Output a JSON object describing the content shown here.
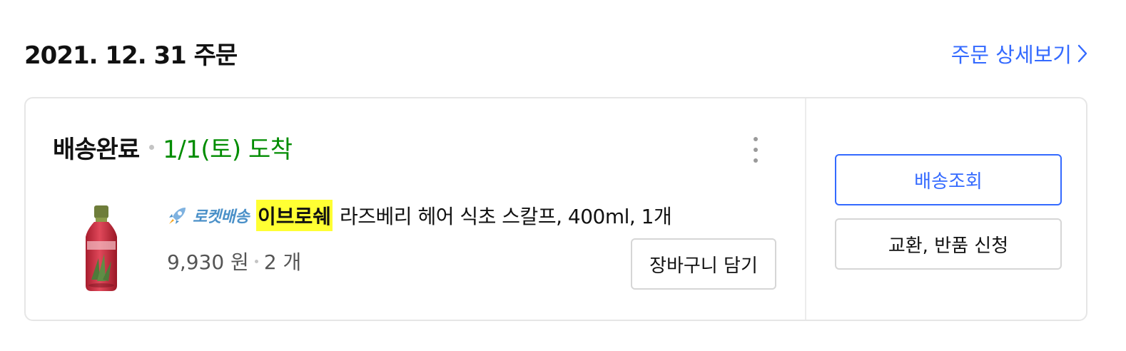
{
  "order": {
    "date_title": "2021. 12. 31 주문",
    "detail_link_label": "주문 상세보기"
  },
  "shipment": {
    "status": "배송완료",
    "arrival": "1/1(토) 도착"
  },
  "product": {
    "rocket_label": "로켓배송",
    "brand": "이브로쉐",
    "name": "라즈베리 헤어 식초 스칼프, 400ml, 1개",
    "price": "9,930 원",
    "quantity": "2 개",
    "cart_button_label": "장바구니 담기"
  },
  "actions": {
    "track_label": "배송조회",
    "return_label": "교환, 반품 신청"
  },
  "colors": {
    "accent": "#346aff",
    "arrival_green": "#008c00",
    "brand_highlight": "#ffff33"
  },
  "icons": {
    "detail_link": "chevron-right-icon",
    "menu": "more-vertical-icon",
    "rocket": "rocket-icon"
  }
}
